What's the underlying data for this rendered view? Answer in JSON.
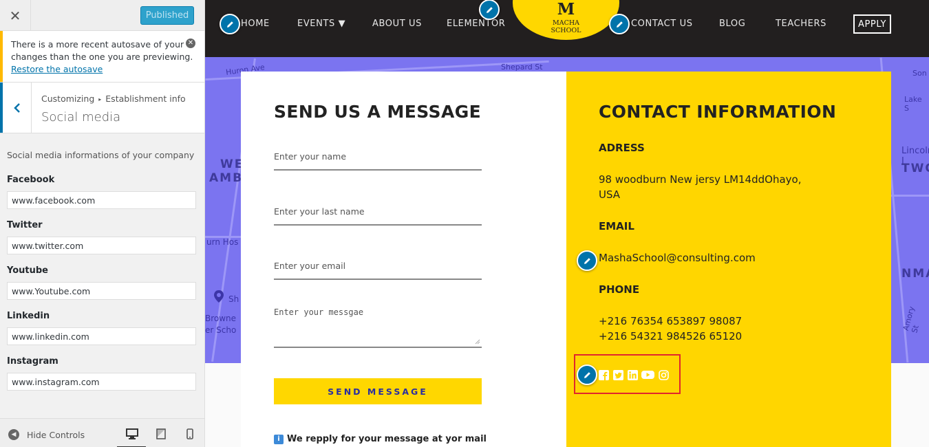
{
  "customizer": {
    "close_icon": "close-icon",
    "publish_label": "Published",
    "notice": {
      "text": "There is a more recent autosave of your changes than the one you are previewing.",
      "link": "Restore the autosave"
    },
    "breadcrumb": {
      "root": "Customizing",
      "section": "Establishment info"
    },
    "section_title": "Social media",
    "description": "Social media informations of your company",
    "fields": [
      {
        "label": "Facebook",
        "value": "www.facebook.com"
      },
      {
        "label": "Twitter",
        "value": "www.twitter.com"
      },
      {
        "label": "Youtube",
        "value": "www.Youtube.com"
      },
      {
        "label": "Linkedin",
        "value": "www.linkedin.com"
      },
      {
        "label": "Instagram",
        "value": "www.instagram.com"
      }
    ],
    "footer": {
      "hide_controls": "Hide Controls",
      "devices": [
        "desktop-icon",
        "tablet-icon",
        "mobile-icon"
      ]
    }
  },
  "site": {
    "nav": [
      "HOME",
      "EVENTS ▼",
      "ABOUT US",
      "ELEMENTOR",
      "CONTACT US",
      "BLOG",
      "TEACHERS"
    ],
    "apply": "APPLY",
    "logo": {
      "letter": "M",
      "line1": "MACHA",
      "line2": "SCHOOL"
    },
    "map_labels": [
      "Huron Ave",
      "Shepard St",
      "WE",
      "AMB",
      "urn Hos",
      "Sh",
      "Browne",
      "er Scho",
      "Lincoln I",
      "TWO",
      "NMA",
      "Lake S",
      "Son",
      "Amory St"
    ],
    "form": {
      "title": "SEND US A MESSAGE",
      "name_placeholder": "Enter your name",
      "last_name_placeholder": "Enter your last name",
      "email_placeholder": "Enter your email",
      "message_placeholder": "Enter your messgae",
      "send_label": "SEND MESSAGE",
      "note": "We repply for your message at yor mail"
    },
    "contact": {
      "title": "CONTACT INFORMATION",
      "address_label": "ADRESS",
      "address_line1": "98 woodburn New jersy LM14ddOhayo,",
      "address_line2": "USA",
      "email_label": "EMAIL",
      "email": "MashaSchool@consulting.com",
      "phone_label": "PHONE",
      "phone1": "+216 76354 653897 98087",
      "phone2": "+216 54321 984526 65120",
      "social_icons": [
        "facebook-icon",
        "twitter-icon",
        "linkedin-icon",
        "youtube-icon",
        "instagram-icon"
      ]
    }
  },
  "colors": {
    "accent": "#ffd700",
    "nav_bg": "#221f1f",
    "map": "#7b74f0",
    "wp_blue": "#0073aa",
    "highlight": "#e0262d"
  }
}
